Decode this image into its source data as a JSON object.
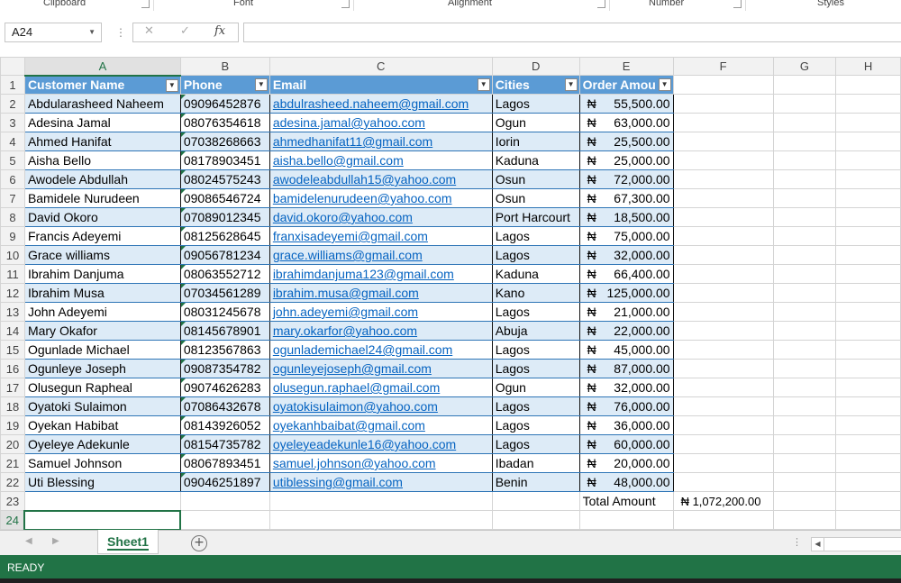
{
  "ribbon": {
    "groups": [
      "Clipboard",
      "Font",
      "Alignment",
      "Number",
      "Styles"
    ]
  },
  "formula_bar": {
    "name_box": "A24",
    "fx": "fx",
    "formula": ""
  },
  "columns": [
    "A",
    "B",
    "C",
    "D",
    "E",
    "F",
    "G",
    "H"
  ],
  "table": {
    "headers": [
      "Customer Name",
      "Phone",
      "Email",
      "Cities",
      "Order Amou"
    ],
    "currency_symbol": "₦",
    "rows": [
      {
        "name": "Abdularasheed Naheem",
        "phone": "09096452876",
        "email": "abdulrasheed.naheem@gmail.com",
        "city": "Lagos",
        "amount": "55,500.00"
      },
      {
        "name": "Adesina Jamal",
        "phone": "08076354618",
        "email": "adesina.jamal@yahoo.com",
        "city": "Ogun",
        "amount": "63,000.00"
      },
      {
        "name": "Ahmed Hanifat",
        "phone": "07038268663",
        "email": "ahmedhanifat11@gmail.com",
        "city": "Iorin",
        "amount": "25,500.00"
      },
      {
        "name": "Aisha Bello",
        "phone": "08178903451",
        "email": "aisha.bello@gmail.com",
        "city": "Kaduna",
        "amount": "25,000.00"
      },
      {
        "name": "Awodele Abdullah",
        "phone": "08024575243",
        "email": "awodeleabdullah15@yahoo.com",
        "city": "Osun",
        "amount": "72,000.00"
      },
      {
        "name": "Bamidele Nurudeen",
        "phone": "09086546724",
        "email": "bamidelenurudeen@yahoo.com",
        "city": "Osun",
        "amount": "67,300.00"
      },
      {
        "name": "David Okoro",
        "phone": "07089012345",
        "email": "david.okoro@yahoo.com",
        "city": "Port Harcourt",
        "amount": "18,500.00"
      },
      {
        "name": "Francis Adeyemi",
        "phone": "08125628645",
        "email": "franxisadeyemi@gmail.com",
        "city": "Lagos",
        "amount": "75,000.00"
      },
      {
        "name": "Grace williams",
        "phone": "09056781234",
        "email": "grace.williams@gmail.com",
        "city": "Lagos",
        "amount": "32,000.00"
      },
      {
        "name": "Ibrahim Danjuma",
        "phone": "08063552712",
        "email": "ibrahimdanjuma123@gmail.com",
        "city": "Kaduna",
        "amount": "66,400.00"
      },
      {
        "name": "Ibrahim Musa",
        "phone": "07034561289",
        "email": "ibrahim.musa@gmail.com",
        "city": "Kano",
        "amount": "125,000.00"
      },
      {
        "name": "John Adeyemi",
        "phone": "08031245678",
        "email": "john.adeyemi@gmail.com",
        "city": "Lagos",
        "amount": "21,000.00"
      },
      {
        "name": "Mary Okafor",
        "phone": "08145678901",
        "email": "mary.okarfor@yahoo.com",
        "city": "Abuja",
        "amount": "22,000.00"
      },
      {
        "name": "Ogunlade Michael",
        "phone": "08123567863",
        "email": "ogunlademichael24@gmail.com",
        "city": "Lagos",
        "amount": "45,000.00"
      },
      {
        "name": "Ogunleye Joseph",
        "phone": "09087354782",
        "email": "ogunleyejoseph@gmail.com",
        "city": "Lagos",
        "amount": "87,000.00"
      },
      {
        "name": "Olusegun Rapheal",
        "phone": "09074626283",
        "email": "olusegun.raphael@gmail.com",
        "city": "Ogun",
        "amount": "32,000.00"
      },
      {
        "name": "Oyatoki Sulaimon",
        "phone": "07086432678",
        "email": "oyatokisulaimon@yahoo.com",
        "city": "Lagos",
        "amount": "76,000.00"
      },
      {
        "name": "Oyekan Habibat",
        "phone": "08143926052",
        "email": "oyekanhbaibat@gmail.com",
        "city": "Lagos",
        "amount": "36,000.00"
      },
      {
        "name": "Oyeleye Adekunle",
        "phone": "08154735782",
        "email": "oyeleyeadekunle16@yahoo.com",
        "city": "Lagos",
        "amount": "60,000.00"
      },
      {
        "name": "Samuel Johnson",
        "phone": "08067893451",
        "email": "samuel.johnson@yahoo.com",
        "city": "Ibadan",
        "amount": "20,000.00"
      },
      {
        "name": "Uti Blessing",
        "phone": "09046251897",
        "email": "utiblessing@gmail.com",
        "city": "Benin",
        "amount": "48,000.00"
      }
    ],
    "total_label": "Total Amount",
    "total_value": "₦ 1,072,200.00"
  },
  "sheet_tabs": [
    "Sheet1"
  ],
  "add_sheet": "+",
  "status_bar": {
    "text": "READY"
  },
  "colors": {
    "accent": "#217346",
    "table_header": "#5b9bd5",
    "band": "#ddebf7",
    "link": "#0563c1"
  }
}
